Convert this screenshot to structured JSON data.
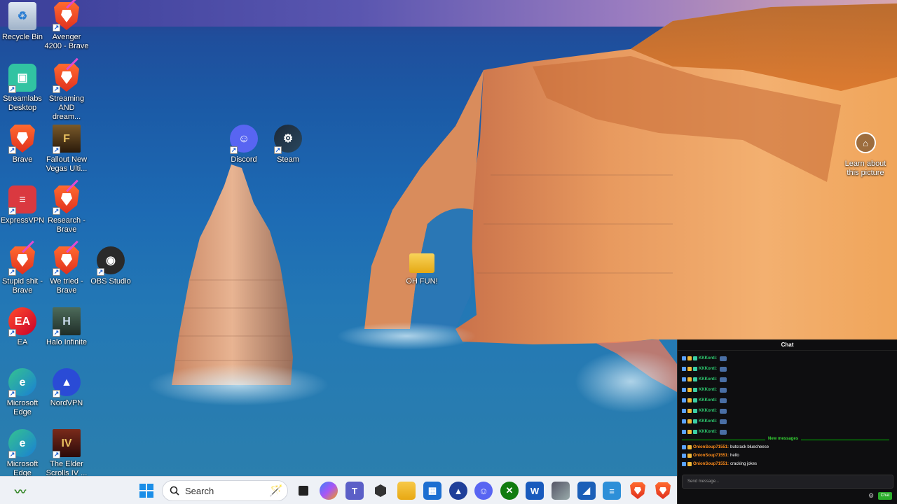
{
  "desktop": {
    "icons": [
      {
        "label": "Recycle Bin",
        "icon": "recycle-bin-icon"
      },
      {
        "label": "Avenger 4200 - Brave",
        "icon": "brave-app-icon"
      },
      {
        "label": "Streamlabs Desktop",
        "icon": "streamlabs-icon"
      },
      {
        "label": "Streaming AND dream...",
        "icon": "brave-app-icon"
      },
      {
        "label": "Brave",
        "icon": "brave-icon"
      },
      {
        "label": "Fallout New Vegas Ulti...",
        "icon": "fallout-icon"
      },
      {
        "label": "ExpressVPN",
        "icon": "expressvpn-icon"
      },
      {
        "label": "Research - Brave",
        "icon": "brave-app-icon"
      },
      {
        "label": "Stupid shit - Brave",
        "icon": "brave-app-icon"
      },
      {
        "label": "We tried - Brave",
        "icon": "brave-app-icon"
      },
      {
        "label": "OBS Studio",
        "icon": "obs-icon"
      },
      {
        "label": "EA",
        "icon": "ea-icon"
      },
      {
        "label": "Halo Infinite",
        "icon": "halo-icon"
      },
      {
        "label": "Microsoft Edge",
        "icon": "edge-icon"
      },
      {
        "label": "NordVPN",
        "icon": "nordvpn-icon"
      },
      {
        "label": "Microsoft Edge",
        "icon": "edge-icon"
      },
      {
        "label": "The Elder Scrolls IV ...",
        "icon": "oblivion-icon"
      },
      {
        "label": "Discord",
        "icon": "discord-icon"
      },
      {
        "label": "Steam",
        "icon": "steam-icon"
      },
      {
        "label": "OH FUN!",
        "icon": "folder-icon"
      }
    ],
    "spotlight": {
      "label": "Learn about this picture"
    }
  },
  "taskbar": {
    "search_label": "Search",
    "apps": [
      "widgets",
      "start",
      "search",
      "task-view",
      "copilot",
      "teams",
      "app-dark",
      "file-explorer",
      "microsoft-store",
      "nordvpn",
      "discord",
      "xbox",
      "word",
      "game",
      "app-blue",
      "notepad",
      "brave",
      "brave-app"
    ]
  },
  "chat": {
    "title": "Chat",
    "messages": [
      {
        "user": "KKKonti:",
        "text": "",
        "user_color": "#2ecc71"
      },
      {
        "user": "KKKonti:",
        "text": "",
        "user_color": "#2ecc71"
      },
      {
        "user": "KKKonti:",
        "text": "",
        "user_color": "#2ecc71"
      },
      {
        "user": "KKKonti:",
        "text": "",
        "user_color": "#2ecc71"
      },
      {
        "user": "KKKonti:",
        "text": "",
        "user_color": "#2ecc71"
      },
      {
        "user": "KKKonti:",
        "text": "",
        "user_color": "#2ecc71"
      },
      {
        "user": "KKKonti:",
        "text": "",
        "user_color": "#2ecc71"
      },
      {
        "user": "KKKonti:",
        "text": "",
        "user_color": "#2ecc71"
      }
    ],
    "new_messages_label": "New messages",
    "new_messages": [
      {
        "user": "OnionSoup71551:",
        "text": "butcrack bluecheese",
        "user_color": "#ff8c1a"
      },
      {
        "user": "OnionSoup71551:",
        "text": "hello",
        "user_color": "#ff8c1a"
      },
      {
        "user": "OnionSoup71551:",
        "text": "cracking jokes",
        "user_color": "#ff8c1a"
      }
    ],
    "input_placeholder": "Send message...",
    "send_label": "Chat"
  }
}
